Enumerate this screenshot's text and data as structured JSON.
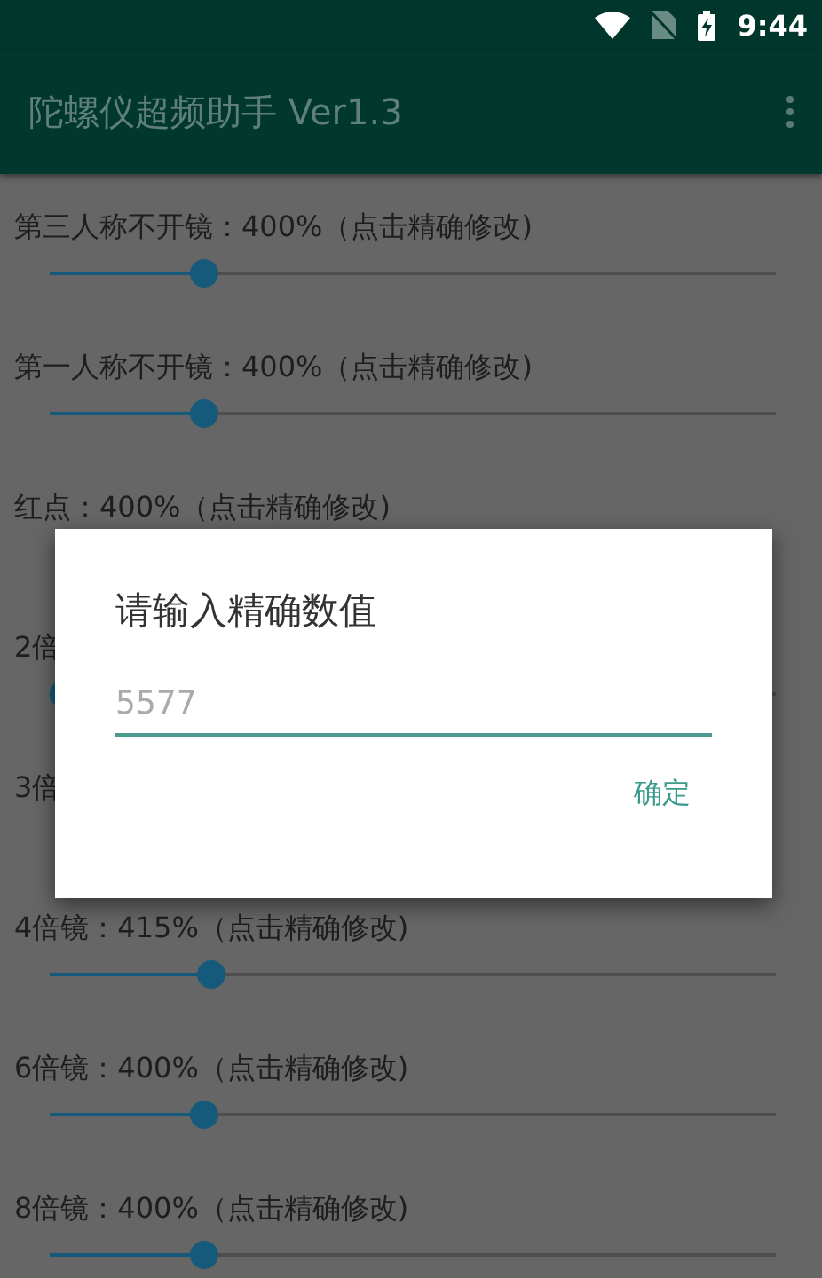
{
  "status_bar": {
    "time": "9:44"
  },
  "app_bar": {
    "title": "陀螺仪超频助手 Ver1.3"
  },
  "settings": [
    {
      "label": "第三人称不开镜：400%（点击精确修改)",
      "level": 0.2
    },
    {
      "label": "第一人称不开镜：400%（点击精确修改)",
      "level": 0.2
    },
    {
      "label": "红点：400%（点击精确修改)"
    },
    {
      "label": "2倍",
      "level": 0
    },
    {
      "label": "3倍"
    },
    {
      "label": "4倍镜：415%（点击精确修改)",
      "level": 0.21
    },
    {
      "label": "6倍镜：400%（点击精确修改)",
      "level": 0.2
    },
    {
      "label": "8倍镜：400%（点击精确修改)",
      "level": 0.2
    }
  ],
  "dialog": {
    "title": "请输入精确数值",
    "input": {
      "placeholder": "5577"
    },
    "buttons": [
      "确定"
    ]
  }
}
